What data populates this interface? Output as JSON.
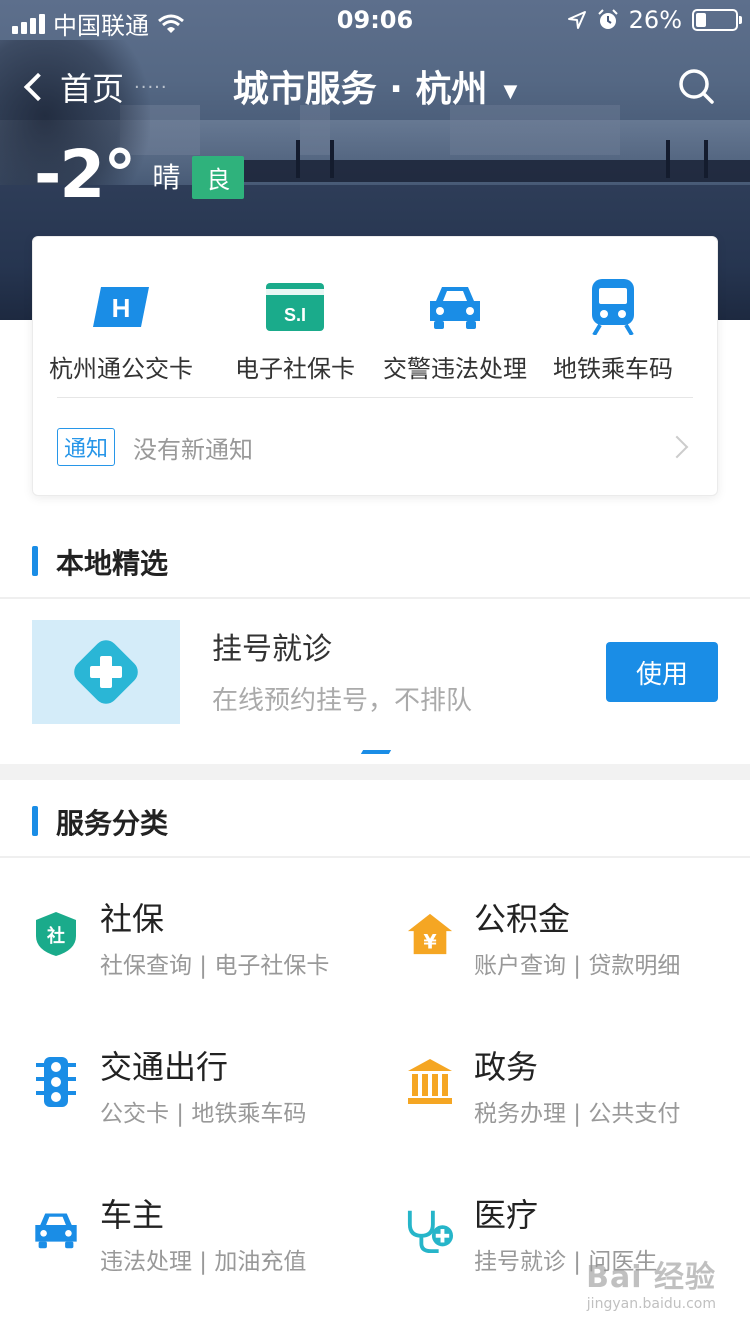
{
  "status_bar": {
    "carrier": "中国联通",
    "time": "09:06",
    "battery_percent": "26%",
    "battery_level": 0.26
  },
  "nav": {
    "back_label": "首页",
    "back_dots": "·····",
    "title": "城市服务 · 杭州",
    "caret": "▼"
  },
  "weather": {
    "temperature": "-2°",
    "condition": "晴",
    "air_quality": "良",
    "air_quality_color": "#2fb27c"
  },
  "shortcuts": [
    {
      "label": "杭州通公交卡",
      "icon": "bus-card-icon"
    },
    {
      "label": "电子社保卡",
      "icon": "social-security-card-icon",
      "icon_text": "S.I"
    },
    {
      "label": "交警违法处理",
      "icon": "car-icon"
    },
    {
      "label": "地铁乘车码",
      "icon": "subway-icon"
    }
  ],
  "shortcut_icon_letter": "H",
  "notice": {
    "tag": "通知",
    "text": "没有新通知"
  },
  "local_picks": {
    "heading": "本地精选",
    "featured": {
      "title": "挂号就诊",
      "description": "在线预约挂号，不排队",
      "button": "使用",
      "icon": "medical-cross-icon"
    }
  },
  "services": {
    "heading": "服务分类",
    "items": [
      {
        "name": "社保",
        "sub": "社保查询 | 电子社保卡",
        "icon": "shield-icon",
        "icon_text": "社",
        "color": "#1aab8b"
      },
      {
        "name": "公积金",
        "sub": "账户查询 | 贷款明细",
        "icon": "house-yuan-icon",
        "icon_text": "¥",
        "color": "#f5a623"
      },
      {
        "name": "交通出行",
        "sub": "公交卡 | 地铁乘车码",
        "icon": "traffic-light-icon",
        "color": "#1a8de6"
      },
      {
        "name": "政务",
        "sub": "税务办理 | 公共支付",
        "icon": "government-building-icon",
        "color": "#f5a623"
      },
      {
        "name": "车主",
        "sub": "违法处理 | 加油充值",
        "icon": "car-icon",
        "color": "#1a8de6"
      },
      {
        "name": "医疗",
        "sub": "挂号就诊 | 问医生",
        "icon": "stethoscope-icon",
        "color": "#26b5c9"
      }
    ]
  },
  "accent_color": "#1a8de6",
  "watermark": {
    "brand": "Bai 经验",
    "url": "jingyan.baidu.com"
  }
}
